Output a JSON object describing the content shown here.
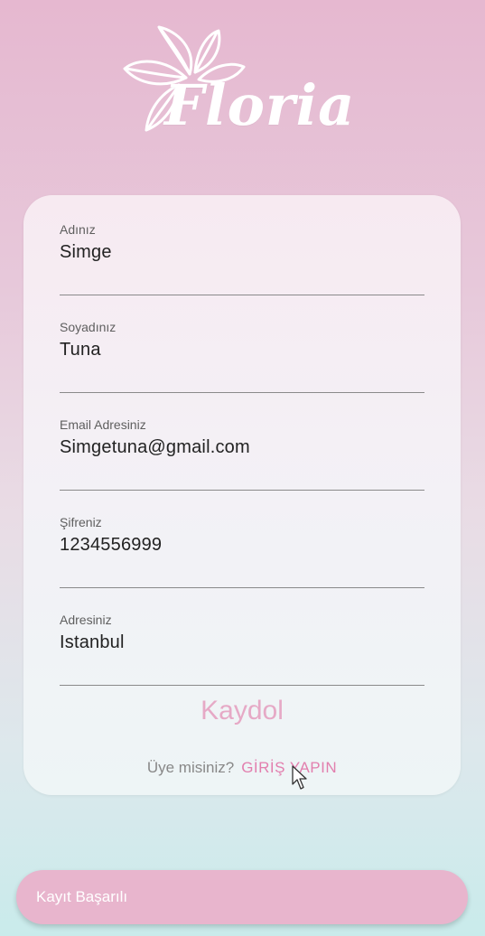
{
  "app": {
    "brand": "Floria",
    "logo_icon": "flower-logo-icon"
  },
  "form": {
    "fields": [
      {
        "label": "Adınız",
        "value": "Simge"
      },
      {
        "label": "Soyadınız",
        "value": "Tuna"
      },
      {
        "label": "Email Adresiniz",
        "value": "Simgetuna@gmail.com"
      },
      {
        "label": "Şifreniz",
        "value": "1234556999"
      },
      {
        "label": "Adresiniz",
        "value": "Istanbul"
      }
    ],
    "submit_label": "Kaydol",
    "login_question": "Üye misiniz?",
    "login_link": "GİRİŞ YAPIN"
  },
  "toast": {
    "message": "Kayıt Başarılı"
  },
  "colors": {
    "accent": "#e6a9c6",
    "link": "#e27fae",
    "toast_bg": "#e8b5cd"
  }
}
